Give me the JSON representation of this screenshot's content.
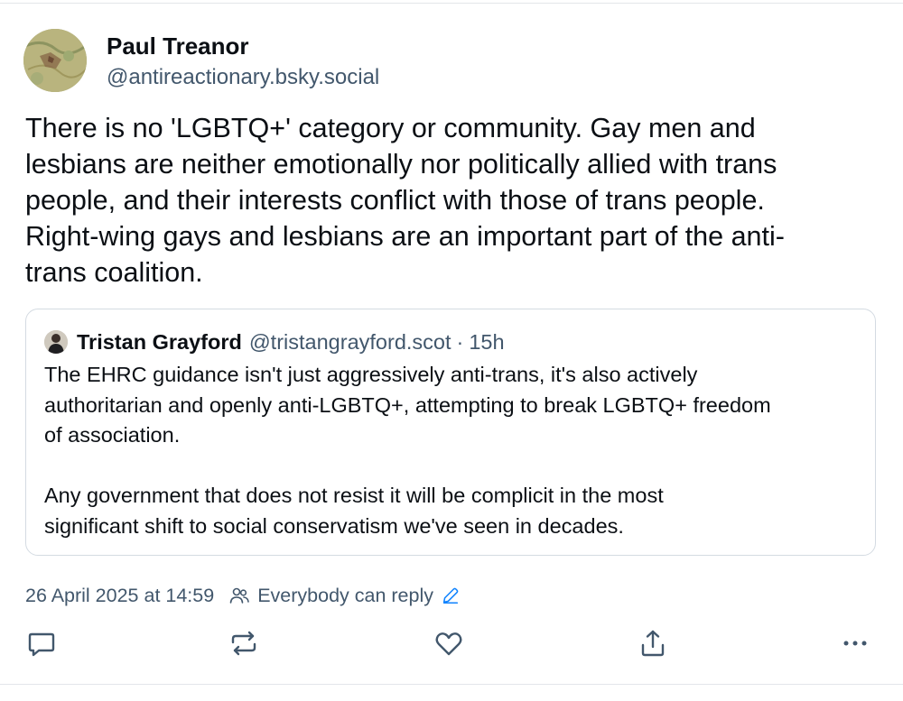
{
  "post": {
    "author_name": "Paul Treanor",
    "author_handle": "@antireactionary.bsky.social",
    "text": "There is no 'LGBTQ+' category or community. Gay men and\nlesbians are neither emotionally nor politically allied with trans\npeople, and their interests conflict with those of trans people.\nRight-wing gays and lesbians are an important part of the anti-\ntrans coalition.",
    "avatar_icon": "avatar-map-image"
  },
  "quote": {
    "author_name": "Tristan Grayford",
    "author_handle": "@tristangrayford.scot",
    "dot": "·",
    "time": "15h",
    "text": "The EHRC guidance isn't just aggressively anti-trans, it's also actively\nauthoritarian and openly anti-LGBTQ+, attempting to break LGBTQ+ freedom\nof association.\n\nAny government that does not resist it will be complicit in the most\nsignificant shift to social conservatism we've seen in decades.",
    "avatar_icon": "avatar-person-image"
  },
  "meta": {
    "timestamp": "26 April 2025 at 14:59",
    "reply_setting": "Everybody can reply",
    "reply_icon": "people-icon",
    "edit_icon": "pencil-icon"
  },
  "actions": {
    "reply_icon": "comment-icon",
    "repost_icon": "repost-icon",
    "like_icon": "heart-icon",
    "share_icon": "share-icon",
    "more_icon": "more-dots-icon"
  },
  "colors": {
    "text": "#0b0f14",
    "muted": "#42576c",
    "border": "#d4dbe2",
    "link_blue": "#1083fe"
  }
}
